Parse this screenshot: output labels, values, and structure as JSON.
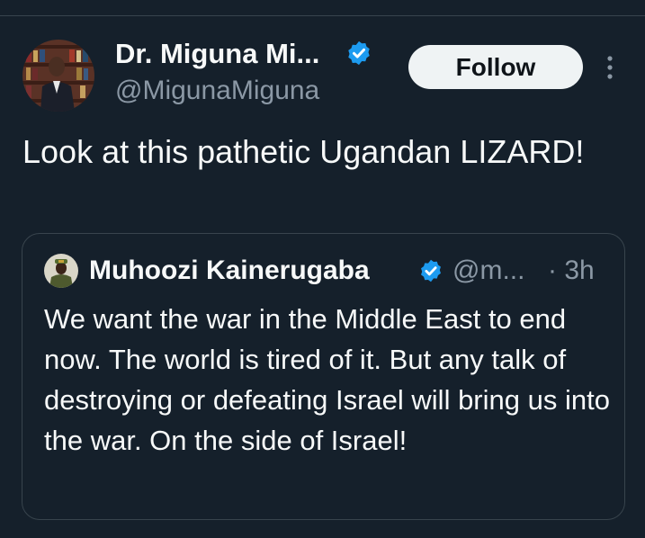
{
  "tweet": {
    "author": {
      "display_name": "Dr. Miguna Mi...",
      "handle": "@MigunaMiguna",
      "verified": true
    },
    "follow_label": "Follow",
    "more_icon": "more-vertical-icon",
    "text": "Look at this pathetic Ugandan LIZARD!"
  },
  "quote": {
    "author": {
      "display_name": "Muhoozi Kainerugaba",
      "handle": "@m...",
      "verified": true
    },
    "time": "· 3h",
    "text": "We want the war in the Middle East to end now. The world is tired of it. But any talk of destroying or defeating Israel will bring us into the war. On the side of Israel!"
  },
  "colors": {
    "background": "#15202b",
    "text": "#f7f9f9",
    "muted": "#8b98a5",
    "verified": "#1d9bf0",
    "border": "#38444d",
    "follow_bg": "#eff3f4"
  }
}
